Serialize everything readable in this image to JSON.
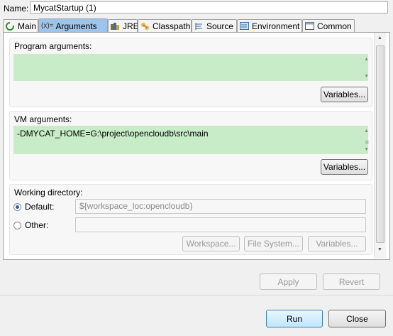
{
  "name_field": {
    "label": "Name:",
    "value": "MycatStartup (1)"
  },
  "tabs": [
    {
      "label": "Main",
      "icon": "main-tab-icon",
      "active": false
    },
    {
      "label": "Arguments",
      "icon": "variable-icon",
      "icon_text": "(x)=",
      "active": true
    },
    {
      "label": "JRE",
      "icon": "jre-library-icon",
      "active": false
    },
    {
      "label": "Classpath",
      "icon": "classpath-icon",
      "active": false
    },
    {
      "label": "Source",
      "icon": "source-icon",
      "active": false
    },
    {
      "label": "Environment",
      "icon": "environment-icon",
      "active": false
    },
    {
      "label": "Common",
      "icon": "common-icon",
      "active": false
    }
  ],
  "program_arguments": {
    "label": "Program arguments:",
    "value": "",
    "variables_button": "Variables..."
  },
  "vm_arguments": {
    "label": "VM arguments:",
    "value": "-DMYCAT_HOME=G:\\project\\opencloudb\\src\\main",
    "variables_button": "Variables..."
  },
  "working_directory": {
    "label": "Working directory:",
    "default_label": "Default:",
    "default_value": "${workspace_loc:opencloudb}",
    "other_label": "Other:",
    "other_value": "",
    "selected": "default",
    "buttons": {
      "workspace": "Workspace...",
      "file_system": "File System...",
      "variables": "Variables..."
    }
  },
  "actions": {
    "apply": "Apply",
    "revert": "Revert"
  },
  "dialog": {
    "run": "Run",
    "close": "Close"
  },
  "colors": {
    "active_tab": "#9dc4ea",
    "textarea_bg": "#c8ecc8",
    "run_border": "#3c7fb1"
  }
}
